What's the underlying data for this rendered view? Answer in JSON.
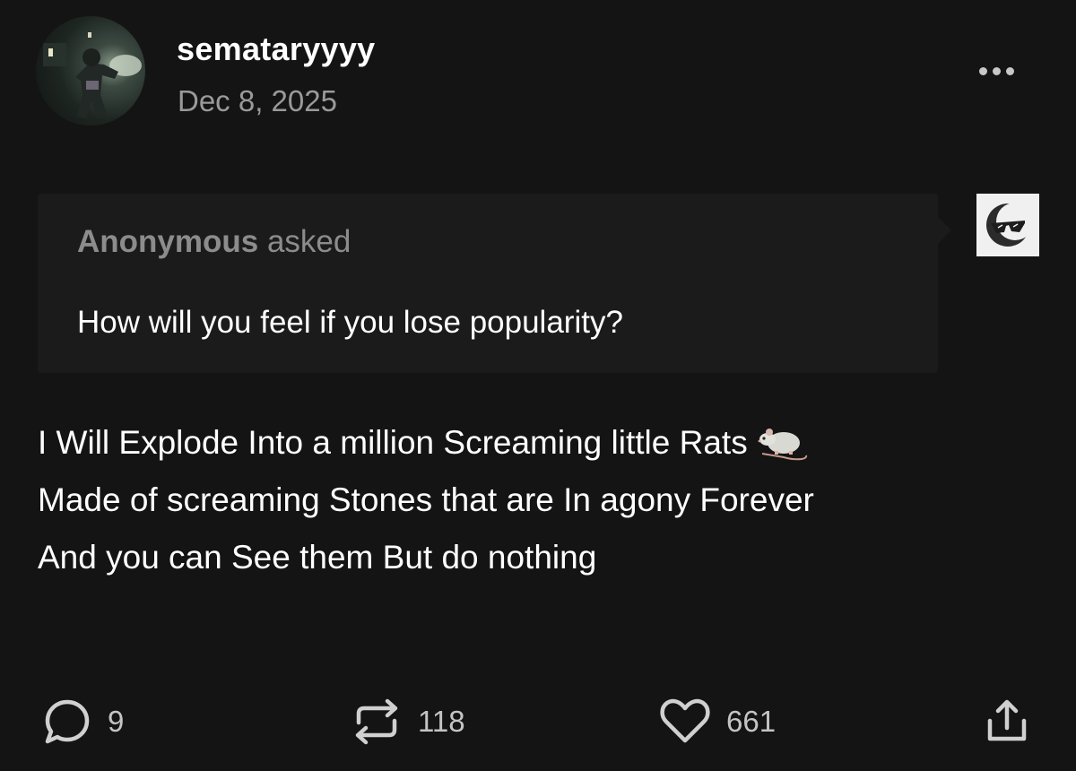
{
  "post": {
    "username": "semataryyyy",
    "date": "Dec 8, 2025",
    "more_icon": "more-horizontal-icon"
  },
  "ask": {
    "asker": "Anonymous",
    "asked_word": "asked",
    "question": "How will you feel if you lose popularity?",
    "asker_avatar_icon": "anonymous-sunglasses-icon"
  },
  "answer": {
    "line1": "I Will Explode Into a million Screaming little Rats",
    "line1_emoji": "rat-emoji",
    "line2": "Made of screaming Stones that are In agony Forever",
    "line3": "And you can See them But do nothing"
  },
  "actions": {
    "replies": "9",
    "reblogs": "118",
    "likes": "661"
  },
  "colors": {
    "background": "#141414",
    "ask_box": "#1b1b1b",
    "muted_text": "#9a9a9a"
  }
}
